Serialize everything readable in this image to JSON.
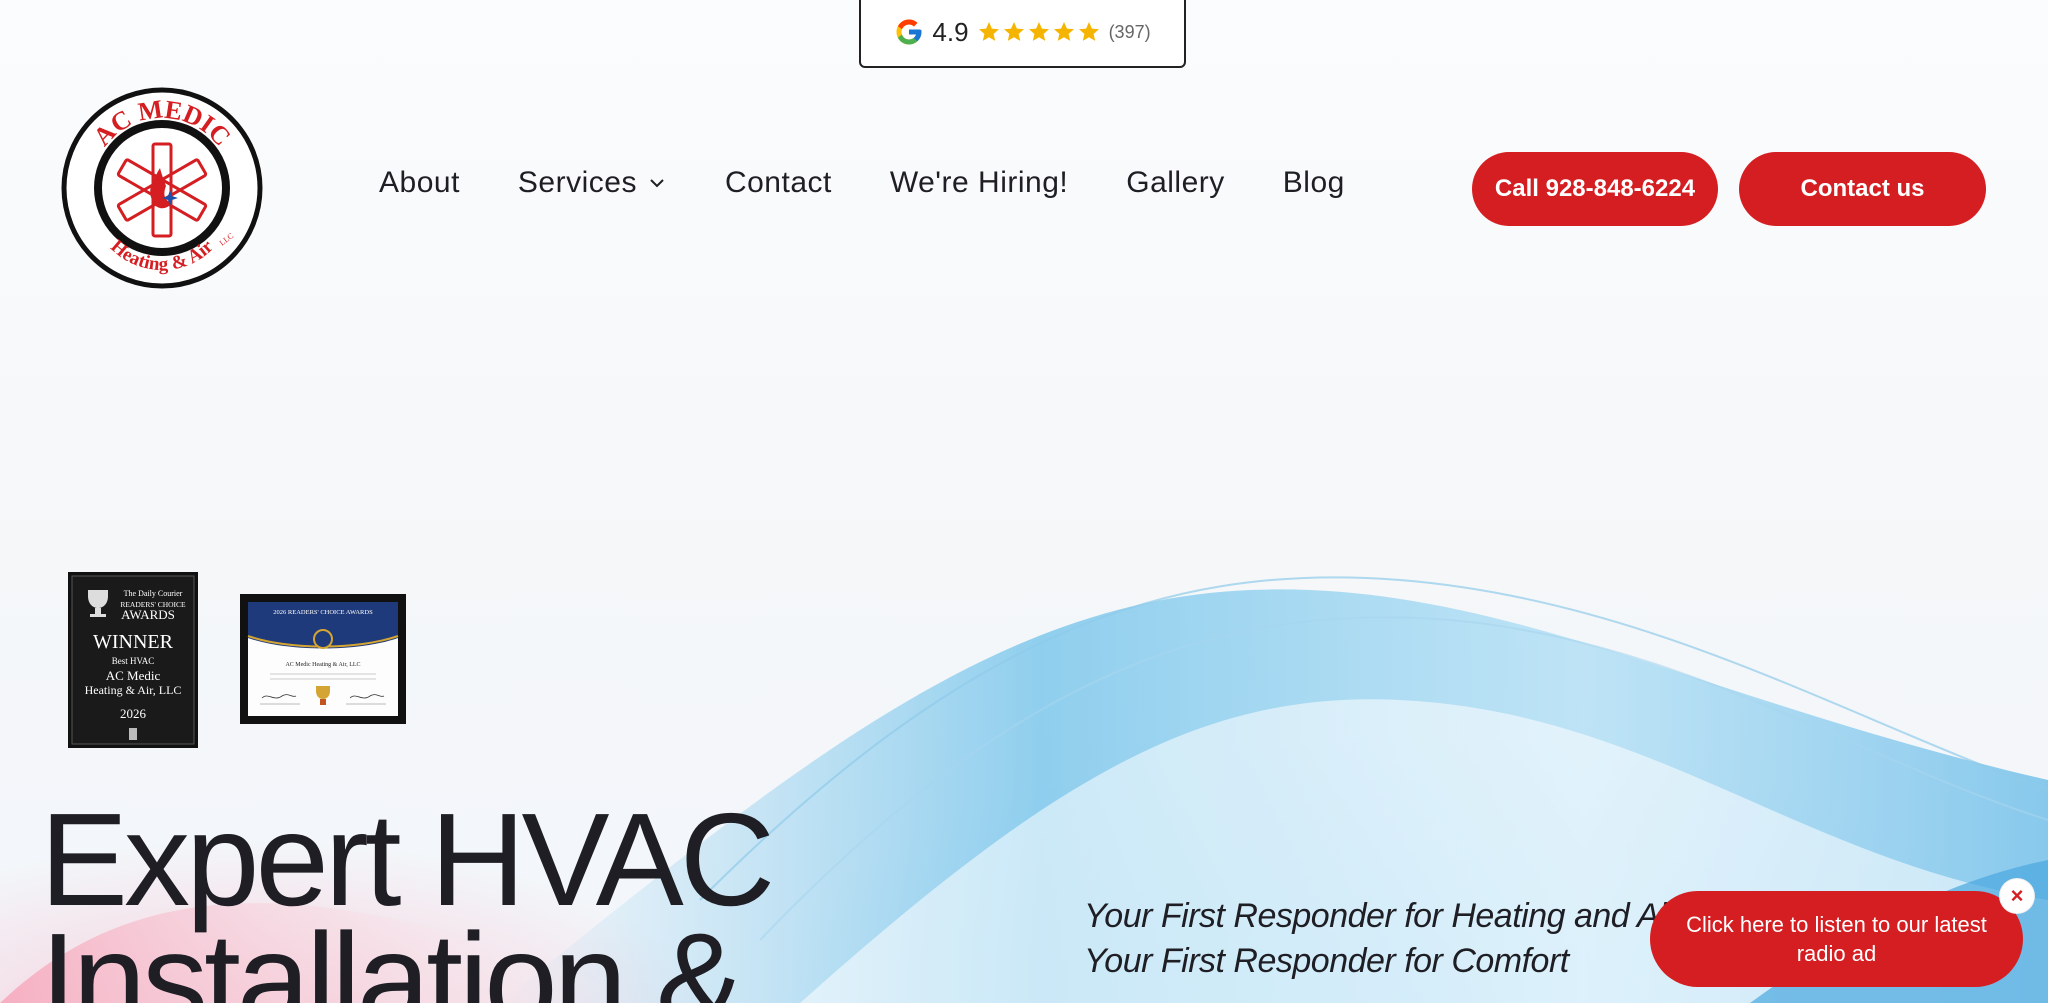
{
  "rating": {
    "score": "4.9",
    "stars": 5,
    "count": "(397)",
    "star_color": "#f5b400"
  },
  "logo": {
    "brand_top": "AC MEDIC",
    "brand_bottom": "Heating & Air",
    "brand_suffix": "LLC",
    "accent": "#d41e22"
  },
  "nav": {
    "items": [
      {
        "label": "About"
      },
      {
        "label": "Services",
        "has_dropdown": true
      },
      {
        "label": "Contact"
      },
      {
        "label": "We're Hiring!"
      },
      {
        "label": "Gallery"
      },
      {
        "label": "Blog"
      }
    ]
  },
  "buttons": {
    "call": "Call 928-848-6224",
    "contact": "Contact us"
  },
  "awards": {
    "plaque": {
      "line1": "The Daily Courier",
      "line2": "READERS' CHOICE",
      "line3": "AWARDS",
      "line4": "WINNER",
      "line5": "Best HVAC",
      "line6": "AC Medic",
      "line7": "Heating & Air, LLC",
      "year": "2026"
    },
    "certificate": {
      "title": "2026 READERS' CHOICE AWARDS",
      "name": "AC Medic Heating & Air, LLC"
    }
  },
  "hero": {
    "title_line1": "Expert HVAC",
    "title_line2": "Installation &",
    "tagline_line1": "Your First Responder for Heating and Air",
    "tagline_line2": "Your First Responder for Comfort"
  },
  "radio_popup": {
    "text": "Click here to listen to our latest radio ad",
    "close": "×"
  },
  "colors": {
    "brand_red": "#d41e22",
    "text_dark": "#1e1e24"
  }
}
